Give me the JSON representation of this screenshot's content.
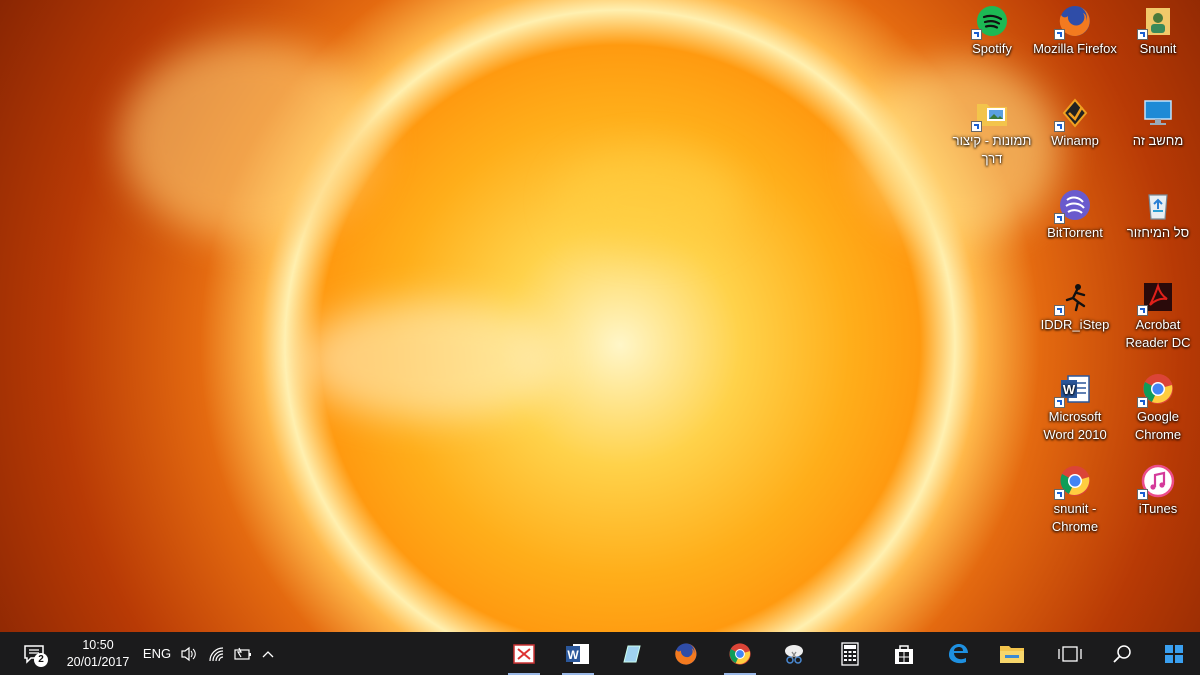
{
  "desktop": {
    "icons": [
      {
        "label": "Spotify",
        "icon": "spotify-icon"
      },
      {
        "label": "Mozilla Firefox",
        "icon": "firefox-icon"
      },
      {
        "label": "Snunit",
        "icon": "user-folder-icon"
      },
      {
        "label": "תמונות - קיצור דרך",
        "icon": "pictures-folder-icon"
      },
      {
        "label": "Winamp",
        "icon": "winamp-icon"
      },
      {
        "label": "מחשב זה",
        "icon": "this-pc-icon"
      },
      {
        "label": "BitTorrent",
        "icon": "bittorrent-icon"
      },
      {
        "label": "סל המיחזור",
        "icon": "recycle-bin-icon"
      },
      {
        "label": "IDDR_iStep",
        "icon": "istep-icon"
      },
      {
        "label": "Acrobat Reader DC",
        "icon": "acrobat-icon"
      },
      {
        "label": "Microsoft Word 2010",
        "icon": "word-icon"
      },
      {
        "label": "Google Chrome",
        "icon": "chrome-icon"
      },
      {
        "label": "snunit - Chrome",
        "icon": "chrome-icon"
      },
      {
        "label": "iTunes",
        "icon": "itunes-icon"
      }
    ]
  },
  "taskbar": {
    "notification_count": "2",
    "time": "10:50",
    "date": "20/01/2017",
    "language": "ENG",
    "apps": [
      {
        "name": "presentation-app-icon",
        "running": true
      },
      {
        "name": "word-icon",
        "running": true
      },
      {
        "name": "notepad-app-icon",
        "running": false
      },
      {
        "name": "firefox-icon",
        "running": false
      },
      {
        "name": "chrome-icon",
        "running": true
      },
      {
        "name": "snipping-tool-icon",
        "running": false
      },
      {
        "name": "calculator-icon",
        "running": false
      },
      {
        "name": "store-icon",
        "running": false
      },
      {
        "name": "edge-icon",
        "running": false
      },
      {
        "name": "file-explorer-icon",
        "running": false
      },
      {
        "name": "task-view-icon",
        "running": false
      },
      {
        "name": "search-icon",
        "running": false
      },
      {
        "name": "start-icon",
        "running": false
      }
    ]
  },
  "colors": {
    "taskbar_bg": "#1b1b1c",
    "accent": "#1a73e8"
  }
}
